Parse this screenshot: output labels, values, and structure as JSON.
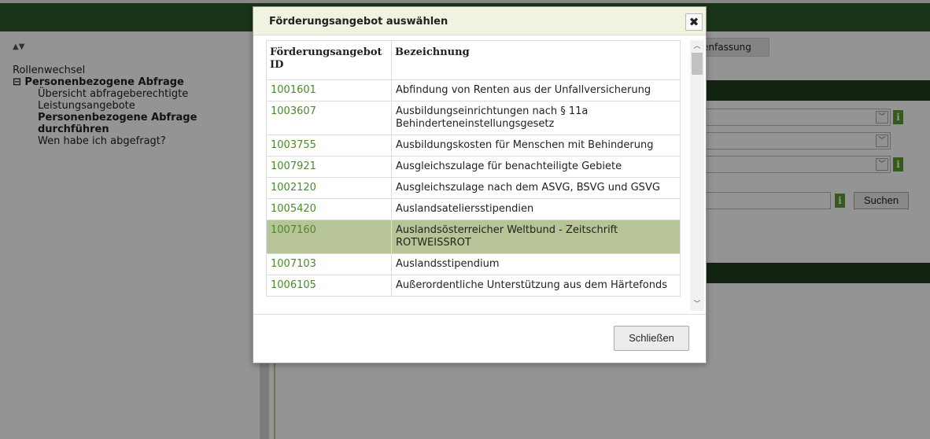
{
  "sidebar": {
    "arrows": "▲▼",
    "items": [
      {
        "label": "Rollenwechsel"
      },
      {
        "label": "⊟ Personenbezogene Abfrage"
      },
      {
        "label": "Übersicht abfrageberechtigte"
      },
      {
        "label": "Leistungsangebote"
      },
      {
        "label": "Personenbezogene Abfrage durchführen"
      },
      {
        "label": "Wen habe ich abgefragt?"
      }
    ]
  },
  "background": {
    "tab_label": "enfassung",
    "search_button": "Suchen",
    "info_label": "i"
  },
  "dialog": {
    "title": "Förderungsangebot auswählen",
    "close_icon": "✖",
    "columns": [
      "Förderungsangebot ID",
      "Bezeichnung"
    ],
    "rows": [
      {
        "id": "1001601",
        "name": "Abfindung von Renten aus der Unfallversicherung"
      },
      {
        "id": "1003607",
        "name": "Ausbildungseinrichtungen nach § 11a Behinderteneinstellungsgesetz"
      },
      {
        "id": "1003755",
        "name": "Ausbildungskosten für Menschen mit Behinderung"
      },
      {
        "id": "1007921",
        "name": "Ausgleichszulage für benachteiligte Gebiete"
      },
      {
        "id": "1002120",
        "name": "Ausgleichszulage nach dem ASVG, BSVG und GSVG"
      },
      {
        "id": "1005420",
        "name": "Auslandsateliersstipendien"
      },
      {
        "id": "1007160",
        "name": "Auslandsösterreicher Weltbund - Zeitschrift ROTWEISSROT"
      },
      {
        "id": "1007103",
        "name": "Auslandsstipendium"
      },
      {
        "id": "1006105",
        "name": "Außerordentliche Unterstützung aus dem Härtefonds"
      }
    ],
    "selected_id": "1007160",
    "close_button": "Schließen"
  }
}
